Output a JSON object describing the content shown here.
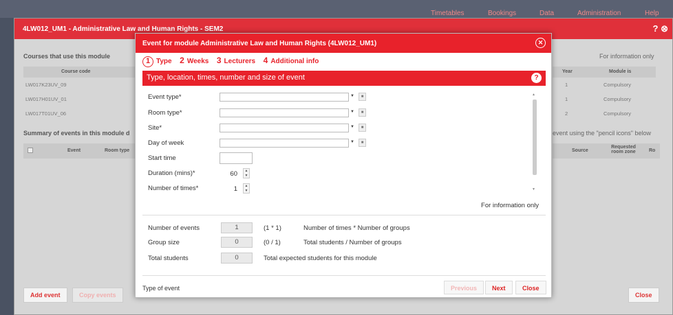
{
  "topnav": [
    "Timetables",
    "Bookings",
    "Data",
    "Administration",
    "Help"
  ],
  "bg_window": {
    "title": "4LW012_UM1 - Administrative Law and Human Rights - SEM2",
    "courses_heading": "Courses that use this module",
    "info_only": "For information only",
    "col_course_code": "Course code",
    "col_year": "Year",
    "col_module_is": "Module is",
    "rows": [
      {
        "code": "LW017K23UV_09",
        "year": "1",
        "module_is": "Compulsory"
      },
      {
        "code": "LW017H01UV_01",
        "year": "1",
        "module_is": "Compulsory"
      },
      {
        "code": "LW017T01UV_06",
        "year": "2",
        "module_is": "Compulsory"
      }
    ],
    "summary_heading": "Summary of events in this module d",
    "pencil_hint": "event using the \"pencil icons\" below",
    "col_event": "Event",
    "col_room_type": "Room type",
    "col_source": "Source",
    "col_requested_room_zone": "Requested room zone",
    "col_ro": "Ro",
    "add_event": "Add event",
    "copy_events": "Copy events",
    "close": "Close"
  },
  "dialog": {
    "title": "Event for module Administrative Law and Human Rights (4LW012_UM1)",
    "close_icon": "close-circle-icon",
    "steps": [
      {
        "num": "1",
        "label": "Type"
      },
      {
        "num": "2",
        "label": "Weeks"
      },
      {
        "num": "3",
        "label": "Lecturers"
      },
      {
        "num": "4",
        "label": "Additional info"
      }
    ],
    "section_title": "Type, location, times, number and size of event",
    "fields": {
      "event_type": "Event type*",
      "room_type": "Room type*",
      "site": "Site*",
      "day_of_week": "Day of week",
      "start_time": "Start time",
      "duration": "Duration (mins)*",
      "duration_value": "60",
      "number_of_times": "Number of times*",
      "number_of_times_value": "1"
    },
    "info_only": "For information only",
    "summary": [
      {
        "label": "Number of events",
        "value": "1",
        "frac": "(1 * 1)",
        "desc": "Number of times * Number of groups"
      },
      {
        "label": "Group size",
        "value": "0",
        "frac": "(0 / 1)",
        "desc": "Total students / Number of groups"
      },
      {
        "label": "Total students",
        "value": "0",
        "frac": "",
        "desc": "Total expected students for this module"
      }
    ],
    "footer_label": "Type of event",
    "btn_previous": "Previous",
    "btn_next": "Next",
    "btn_close": "Close"
  }
}
